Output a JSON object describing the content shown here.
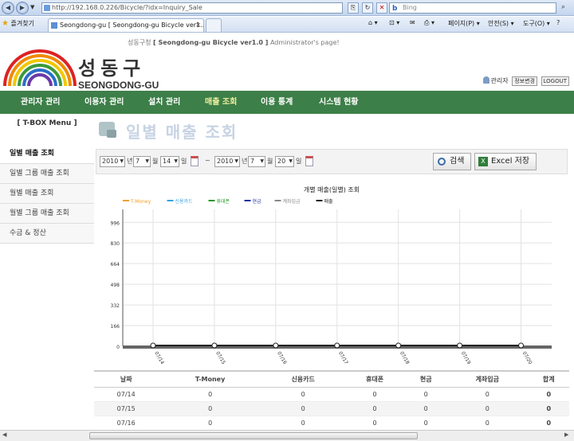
{
  "browser": {
    "address": "http://192.168.0.226/Bicycle/?idx=Inquiry_Sale",
    "search_placeholder": "Bing",
    "favorites_label": "즐겨찾기",
    "tabs": [
      {
        "label": "Seongdong-gu [ Seongdong-gu Bicycle ver1.0 ]"
      },
      {
        "label": "Seongdong-gu [ Seongdong-gu Bicycle ver1..."
      }
    ],
    "toolbar": {
      "page": "페이지(P) ▾",
      "safety": "안전(S) ▾",
      "tools": "도구(O) ▾",
      "help": "?"
    }
  },
  "header": {
    "top_text_a": "성동구청",
    "top_text_b": "[ Seongdong-gu Bicycle ver1.0 ]",
    "top_text_c": "Administrator's page!",
    "logo_korean": "성동구",
    "logo_english": "SEONGDONG-GU",
    "admin_label": "관리자",
    "change_info": "정보변경",
    "logout": "LOGOUT"
  },
  "nav": {
    "items": [
      "관리자 관리",
      "이용자 관리",
      "설치 관리",
      "매출 조회",
      "이용 통계",
      "시스템 현황"
    ],
    "active": "매출 조회"
  },
  "sidebar": {
    "title": "[ T-BOX Menu ]",
    "items": [
      "일별 매출 조회",
      "일별 그룹 매출 조회",
      "월별 매출 조회",
      "월별 그룹 매출 조회",
      "수금 & 정산"
    ]
  },
  "page_title": "일별 매출 조회",
  "search": {
    "from_year": "2010",
    "from_month": "7",
    "from_day": "14",
    "to_year": "2010",
    "to_month": "7",
    "to_day": "20",
    "year_unit": "년",
    "month_unit": "월",
    "day_unit": "일",
    "tilde": "~",
    "search_btn": "검색",
    "excel_btn": "Excel 저장"
  },
  "chart_data": {
    "type": "line",
    "title": "개별 매출(일별) 조회",
    "x": [
      "07/14",
      "07/15",
      "07/16",
      "07/17",
      "07/18",
      "07/19",
      "07/20"
    ],
    "yticks": [
      0,
      166,
      332,
      498,
      664,
      830,
      996
    ],
    "ylim": [
      0,
      1100
    ],
    "grid": true,
    "legend_position": "top-left",
    "series": [
      {
        "name": "T-Money",
        "color": "#f0a030",
        "values": [
          0,
          0,
          0,
          0,
          0,
          0,
          0
        ]
      },
      {
        "name": "신용카드",
        "color": "#3aa0e0",
        "values": [
          0,
          0,
          0,
          0,
          0,
          0,
          0
        ]
      },
      {
        "name": "휴대폰",
        "color": "#2a9a2a",
        "values": [
          0,
          0,
          0,
          0,
          0,
          0,
          0
        ]
      },
      {
        "name": "현금",
        "color": "#2030a0",
        "values": [
          0,
          0,
          0,
          0,
          0,
          0,
          0
        ]
      },
      {
        "name": "계좌입금",
        "color": "#888888",
        "values": [
          0,
          0,
          0,
          0,
          0,
          0,
          0
        ]
      },
      {
        "name": "매출",
        "color": "#222222",
        "values": [
          0,
          0,
          0,
          0,
          0,
          0,
          0
        ]
      }
    ]
  },
  "table": {
    "headers": [
      "날짜",
      "T-Money",
      "신용카드",
      "휴대폰",
      "현금",
      "계좌입금",
      "합계"
    ],
    "rows": [
      [
        "07/14",
        "0",
        "0",
        "0",
        "0",
        "0",
        "0"
      ],
      [
        "07/15",
        "0",
        "0",
        "0",
        "0",
        "0",
        "0"
      ],
      [
        "07/16",
        "0",
        "0",
        "0",
        "0",
        "0",
        "0"
      ]
    ]
  }
}
